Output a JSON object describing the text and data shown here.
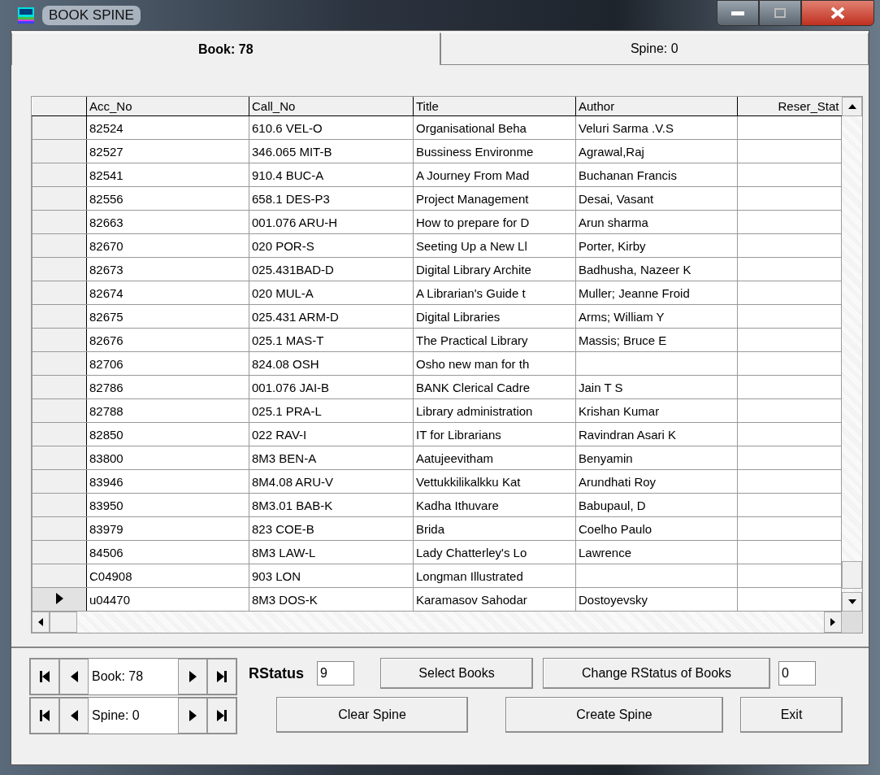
{
  "window": {
    "title": "BOOK SPINE"
  },
  "tabs": [
    {
      "label": "Book: 78",
      "selected": true
    },
    {
      "label": "Spine: 0",
      "selected": false
    }
  ],
  "table": {
    "columns": [
      "Acc_No",
      "Call_No",
      "Title",
      "Author",
      "Reser_Stat"
    ],
    "rows": [
      {
        "selected": false,
        "cells": [
          "82524",
          "610.6 VEL-O",
          "Organisational Beha",
          "Veluri  Sarma .V.S",
          ""
        ]
      },
      {
        "selected": false,
        "cells": [
          "82527",
          "346.065  MIT-B",
          "Bussiness Environme",
          "Agrawal,Raj",
          ""
        ]
      },
      {
        "selected": false,
        "cells": [
          "82541",
          "910.4  BUC-A",
          "A Journey From Mad",
          "Buchanan Francis",
          ""
        ]
      },
      {
        "selected": false,
        "cells": [
          "82556",
          "658.1  DES-P3",
          "Project Management",
          "Desai, Vasant",
          ""
        ]
      },
      {
        "selected": false,
        "cells": [
          "82663",
          "001.076  ARU-H",
          "How to prepare for D",
          "Arun sharma",
          ""
        ]
      },
      {
        "selected": false,
        "cells": [
          "82670",
          "020  POR-S",
          "Seeting Up a New Ll",
          "Porter, Kirby",
          ""
        ]
      },
      {
        "selected": false,
        "cells": [
          "82673",
          "025.431BAD-D",
          "Digital Library Archite",
          "Badhusha, Nazeer K",
          ""
        ]
      },
      {
        "selected": false,
        "cells": [
          "82674",
          "020  MUL-A",
          "A Librarian's Guide t",
          "Muller; Jeanne Froid",
          ""
        ]
      },
      {
        "selected": false,
        "cells": [
          "82675",
          "025.431 ARM-D",
          "Digital Libraries",
          "Arms; William Y",
          ""
        ]
      },
      {
        "selected": false,
        "cells": [
          "82676",
          "025.1  MAS-T",
          "The Practical Library",
          "Massis; Bruce E",
          ""
        ]
      },
      {
        "selected": false,
        "cells": [
          "82706",
          "824.08  OSH",
          "Osho new man for th",
          "",
          ""
        ]
      },
      {
        "selected": false,
        "cells": [
          "82786",
          "001.076  JAI-B",
          "BANK Clerical Cadre",
          "Jain T S",
          ""
        ]
      },
      {
        "selected": false,
        "cells": [
          "82788",
          "025.1  PRA-L",
          "Library administration",
          "Krishan Kumar",
          ""
        ]
      },
      {
        "selected": false,
        "cells": [
          "82850",
          "022  RAV-I",
          "IT for Librarians",
          "Ravindran Asari K",
          ""
        ]
      },
      {
        "selected": false,
        "cells": [
          "83800",
          "8M3  BEN-A",
          "Aatujeevitham",
          "Benyamin",
          ""
        ]
      },
      {
        "selected": false,
        "cells": [
          "83946",
          "8M4.08  ARU-V",
          "Vettukkilikalkku Kat",
          "Arundhati Roy",
          ""
        ]
      },
      {
        "selected": false,
        "cells": [
          "83950",
          "8M3.01  BAB-K",
          "Kadha Ithuvare",
          "Babupaul, D",
          ""
        ]
      },
      {
        "selected": false,
        "cells": [
          "83979",
          "823  COE-B",
          "Brida",
          "Coelho Paulo",
          ""
        ]
      },
      {
        "selected": false,
        "cells": [
          "84506",
          "8M3  LAW-L",
          "Lady Chatterley's Lo",
          "Lawrence",
          ""
        ]
      },
      {
        "selected": false,
        "cells": [
          "C04908",
          "903  LON",
          "Longman Illustrated",
          "",
          ""
        ]
      },
      {
        "selected": true,
        "cells": [
          "u04470",
          "8M3  DOS-K",
          "Karamasov Sahodar",
          "Dostoyevsky",
          ""
        ]
      }
    ]
  },
  "navigators": [
    {
      "label": "Book: 78"
    },
    {
      "label": "Spine: 0"
    }
  ],
  "rstatus": {
    "label": "RStatus",
    "value": "9"
  },
  "buttons_top": [
    "Select Books",
    "Change RStatus of Books"
  ],
  "count_field": {
    "value": "0"
  },
  "buttons_bottom": [
    "Clear Spine",
    "Create Spine",
    "Exit"
  ]
}
